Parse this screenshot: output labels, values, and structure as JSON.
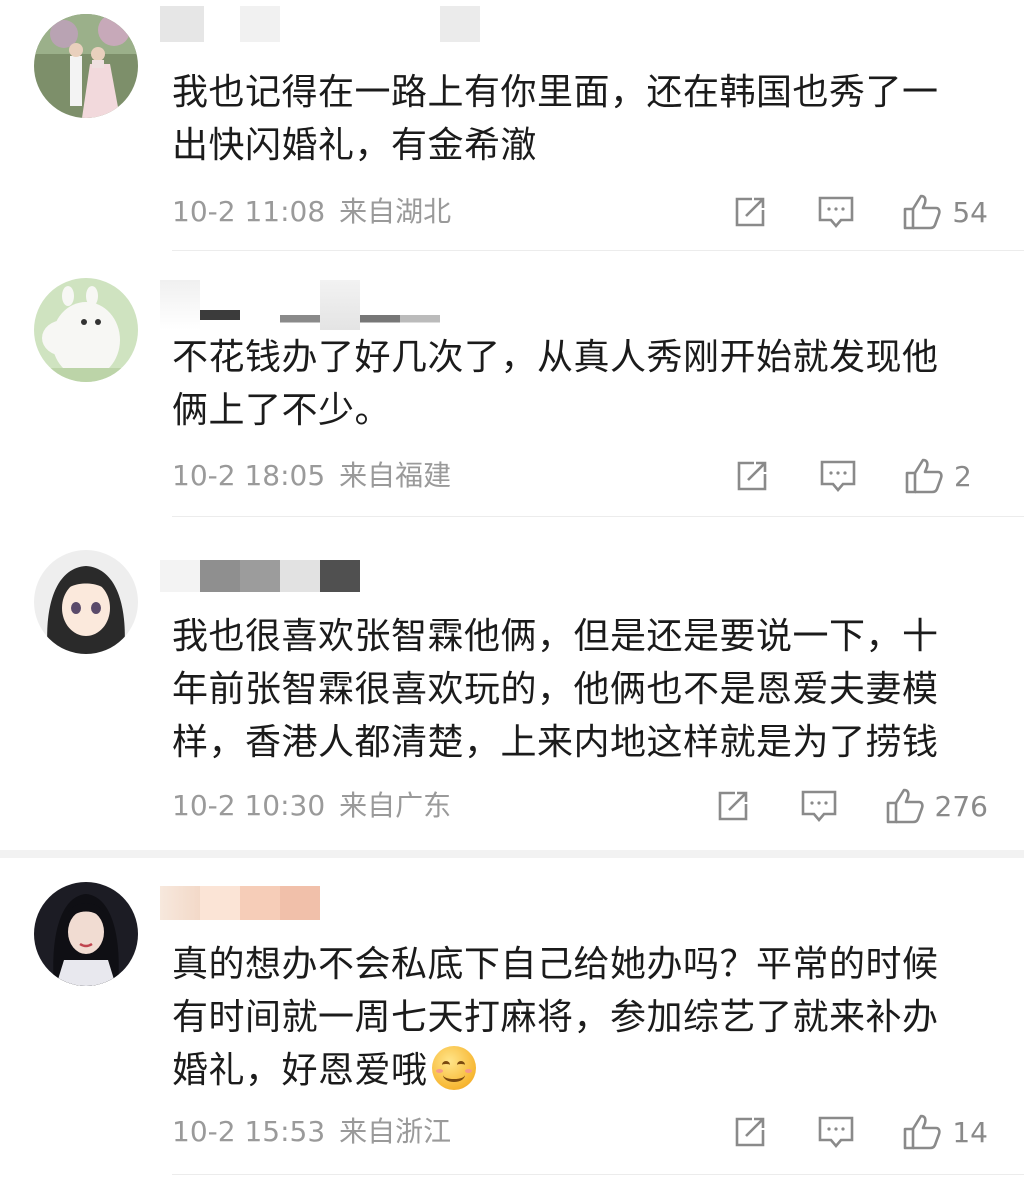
{
  "comments": [
    {
      "text": "我也记得在一路上有你里面，还在韩国也秀了一出快闪婚礼，有金希澈",
      "time": "10-2 11:08",
      "location": "来自湖北",
      "likes": "54",
      "avatar_icon": "couple-wedding-avatar"
    },
    {
      "text": "不花钱办了好几次了，从真人秀刚开始就发现他俩上了不少。",
      "time": "10-2 18:05",
      "location": "来自福建",
      "likes": "2",
      "avatar_icon": "moomin-avatar"
    },
    {
      "text": "我也很喜欢张智霖他俩，但是还是要说一下，十年前张智霖很喜欢玩的，他俩也不是恩爱夫妻模样，香港人都清楚，上来内地这样就是为了捞钱",
      "time": "10-2 10:30",
      "location": "来自广东",
      "likes": "276",
      "avatar_icon": "anime-girl-avatar"
    },
    {
      "text": "真的想办不会私底下自己给她办吗？平常的时候有时间就一周七天打麻将，参加综艺了就来补办婚礼，好恩爱哦",
      "time": "10-2 15:53",
      "location": "来自浙江",
      "likes": "14",
      "avatar_icon": "dark-hair-girl-avatar"
    }
  ],
  "colors": {
    "text": "#1b1b1b",
    "meta": "#9a9a9a",
    "icon": "#8a8a8a",
    "divider": "#ececec",
    "band": "#f2f2f2"
  },
  "icons": [
    "repost-icon",
    "comment-icon",
    "like-icon",
    "smile-emoji"
  ]
}
